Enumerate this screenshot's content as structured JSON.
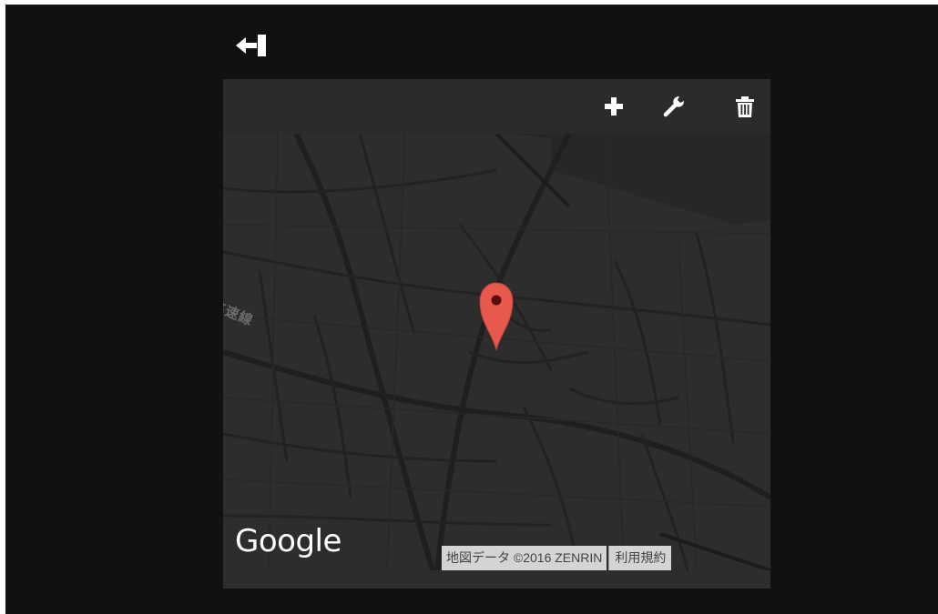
{
  "header": {
    "back_icon": "collapse-left-icon"
  },
  "toolbar": {
    "add_icon": "plus-icon",
    "settings_icon": "wrench-icon",
    "delete_icon": "trash-icon"
  },
  "map": {
    "road_label": "高速線",
    "marker_icon": "map-pin-icon",
    "marker_color": "#e8584c",
    "logo_text": "Google",
    "attribution": "地図データ ©2016 ZENRIN",
    "terms_label": "利用規約"
  }
}
